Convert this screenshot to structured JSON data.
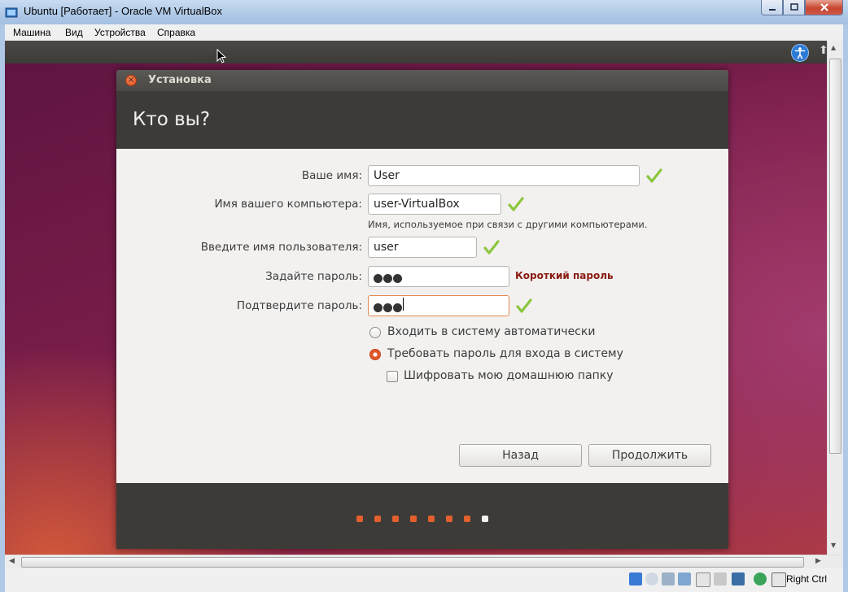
{
  "host": {
    "title": "Ubuntu [Работает] - Oracle VM VirtualBox",
    "menu": [
      "Машина",
      "Вид",
      "Устройства",
      "Справка"
    ],
    "host_key": "Right Ctrl"
  },
  "installer": {
    "window_title": "Установка",
    "heading": "Кто вы?",
    "fields": {
      "name": {
        "label": "Ваше имя:",
        "value": "User"
      },
      "computer": {
        "label": "Имя вашего компьютера:",
        "value": "user-VirtualBox",
        "hint": "Имя, используемое при связи с другими компьютерами."
      },
      "username": {
        "label": "Введите имя пользователя:",
        "value": "user"
      },
      "password": {
        "label": "Задайте пароль:",
        "warning": "Короткий пароль"
      },
      "confirm": {
        "label": "Подтвердите пароль:"
      }
    },
    "options": {
      "auto_login": "Входить в систему автоматически",
      "require_password": "Требовать пароль для входа в систему",
      "encrypt_home": "Шифровать мою домашнюю папку"
    },
    "buttons": {
      "back": "Назад",
      "continue": "Продолжить"
    },
    "progress": {
      "total_steps": 8,
      "current_step": 8
    }
  },
  "colors": {
    "accent": "#e2582a",
    "warning": "#8a1a10",
    "check": "#8cc63f"
  }
}
